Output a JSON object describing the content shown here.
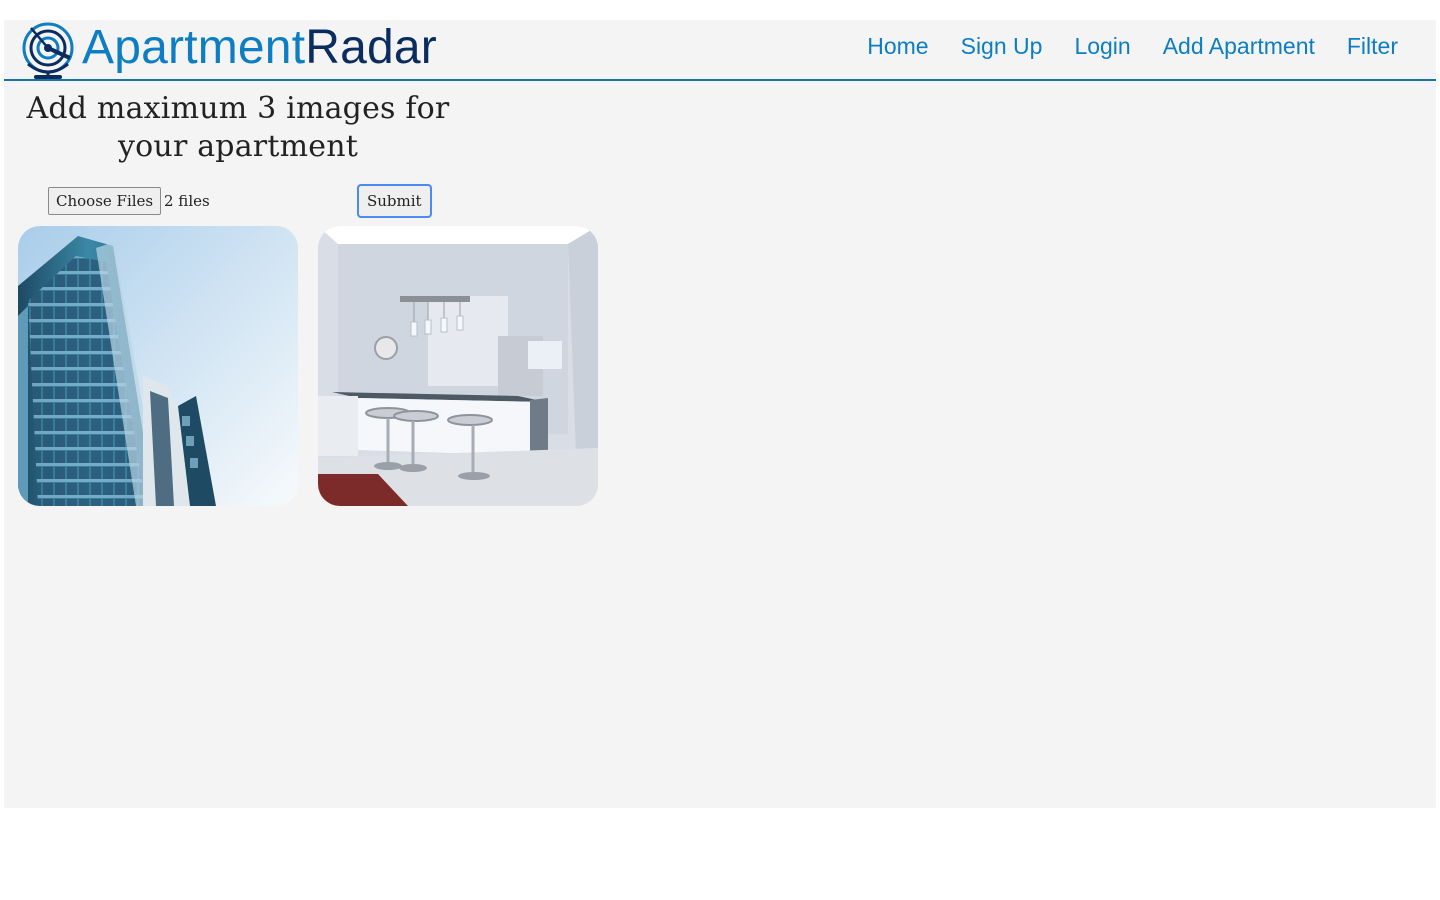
{
  "brand": {
    "name_part1": "Apartment",
    "name_part2": "Radar",
    "icon": "radar-globe-icon",
    "colors": {
      "primary": "#0d7ec4",
      "dark": "#0b2c5f"
    }
  },
  "nav": {
    "items": [
      {
        "label": "Home"
      },
      {
        "label": "Sign Up"
      },
      {
        "label": "Login"
      },
      {
        "label": "Add Apartment"
      },
      {
        "label": "Filter"
      }
    ]
  },
  "upload": {
    "heading": "Add maximum 3 images for your apartment",
    "choose_files_label": "Choose Files",
    "file_status": "2 files",
    "submit_label": "Submit"
  },
  "previews": [
    {
      "subject": "apartment-building-exterior"
    },
    {
      "subject": "kitchen-interior"
    }
  ]
}
